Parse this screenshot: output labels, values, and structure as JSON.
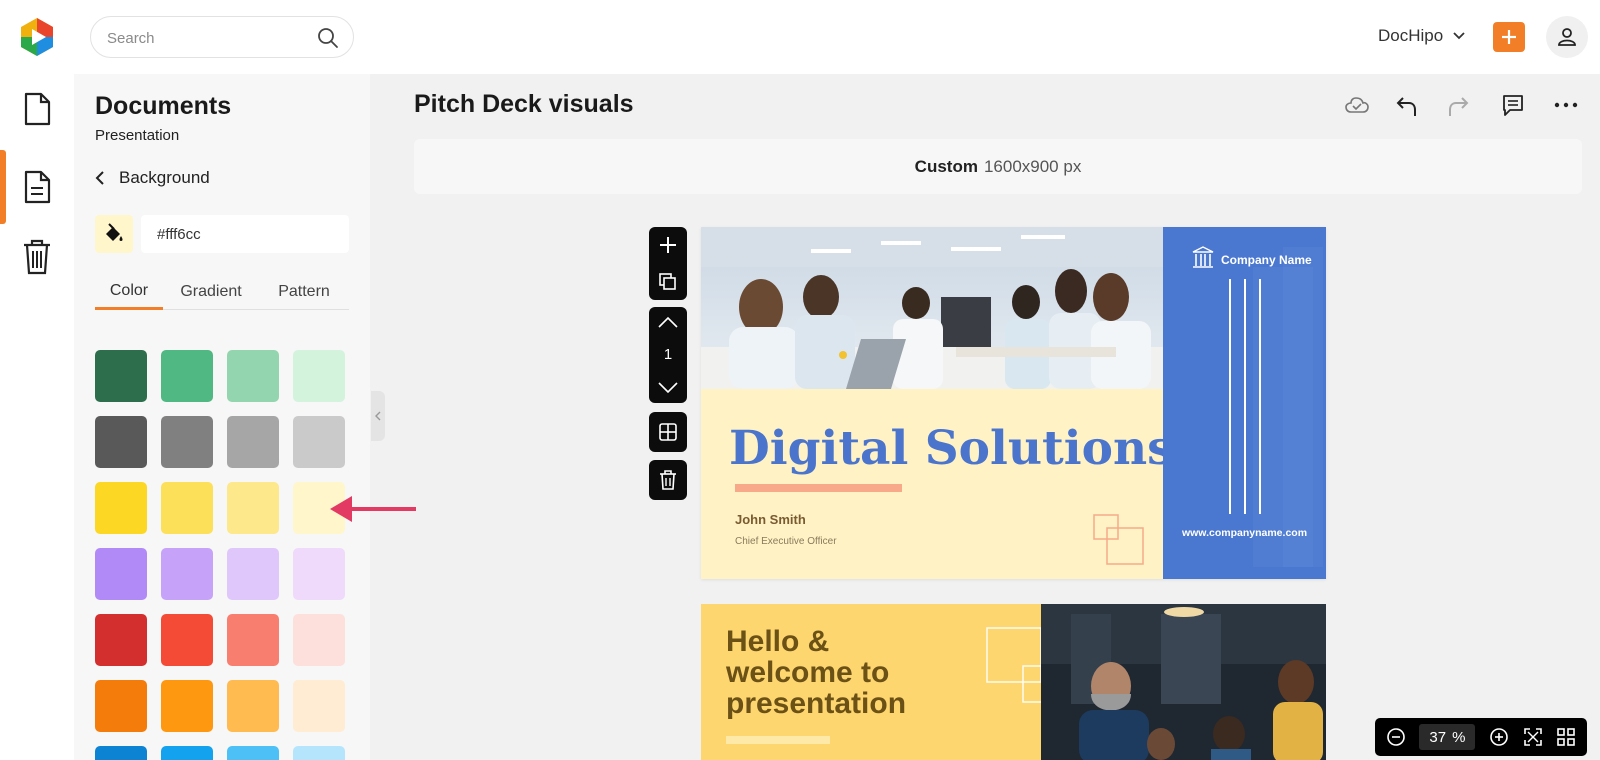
{
  "header": {
    "search_placeholder": "Search",
    "account_name": "DocHipo",
    "accent_color": "#f27f28"
  },
  "rail": {
    "items": [
      {
        "icon": "document-icon",
        "active": false
      },
      {
        "icon": "file-text-icon",
        "active": true
      },
      {
        "icon": "trash-icon",
        "active": false
      }
    ]
  },
  "panel": {
    "title": "Documents",
    "subtitle": "Presentation",
    "back_label": "Background",
    "hex_value": "#fff6cc",
    "tabs": [
      "Color",
      "Gradient",
      "Pattern"
    ],
    "active_tab": "Color",
    "swatch_rows": [
      [
        "#2d6e4c",
        "#4fb883",
        "#92d5ae",
        "#d3f3dd"
      ],
      [
        "#595959",
        "#808080",
        "#a6a6a6",
        "#cacaca"
      ],
      [
        "#fcd824",
        "#fde059",
        "#fde98c",
        "#fff6cc"
      ],
      [
        "#b18af8",
        "#c6a3f8",
        "#dfc7fb",
        "#f0dafc"
      ],
      [
        "#d32f2f",
        "#f44b37",
        "#f87f70",
        "#fddfdc"
      ],
      [
        "#f47c0a",
        "#ff9811",
        "#ffba50",
        "#ffecd2"
      ],
      [
        "#0d83d4",
        "#12a2ee",
        "#4dc1f5",
        "#b5e5fc"
      ]
    ]
  },
  "main": {
    "doc_title": "Pitch Deck visuals",
    "size_label": "Custom",
    "size_value": "1600x900 px",
    "page_number": "1",
    "zoom": "37",
    "zoom_unit": "%"
  },
  "slide1": {
    "title": "Digital Solutions",
    "name": "John Smith",
    "role": "Chief Executive Officer",
    "company": "Company Name",
    "url": "www.companyname.com"
  },
  "slide2": {
    "title_line1": "Hello &",
    "title_line2": "welcome to",
    "title_line3": "presentation"
  }
}
